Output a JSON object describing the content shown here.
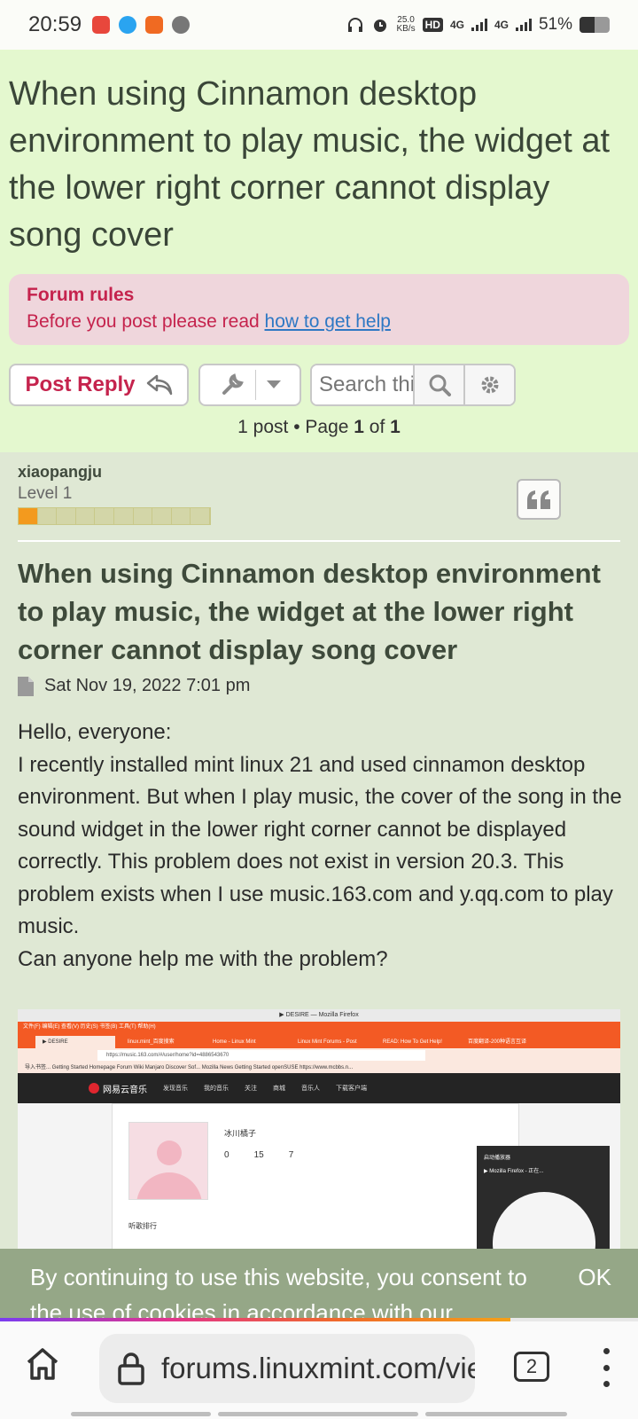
{
  "status_bar": {
    "time": "20:59",
    "net_speed_value": "25.0",
    "net_speed_unit": "KB/s",
    "hd_label": "HD",
    "signal1": "4G",
    "signal2": "4G",
    "battery_text": "51%",
    "battery_level": 0.51,
    "app_icons": [
      "netease-music-icon",
      "qq-icon",
      "rocket-app-icon",
      "wechat-icon"
    ]
  },
  "topic": {
    "title": "When using Cinnamon desktop environment to play music, the widget at the lower right corner cannot display song cover"
  },
  "rules": {
    "title": "Forum rules",
    "text": "Before you post please read ",
    "link": "how to get help"
  },
  "toolbar": {
    "post_reply": "Post Reply",
    "search_placeholder": "Search this topic…"
  },
  "pagination": {
    "prefix": "1 post • Page ",
    "current": "1",
    "of": " of ",
    "total": "1"
  },
  "post": {
    "author": "xiaopangju",
    "rank": "Level 1",
    "rank_level": 1,
    "rank_max": 10,
    "title": "When using Cinnamon desktop environment to play music, the widget at the lower right corner cannot display song cover",
    "date": "Sat Nov 19, 2022 7:01 pm",
    "body": [
      "Hello, everyone:",
      "I recently installed mint linux 21 and used cinnamon desktop environment. But when I play music, the cover of the song in the sound widget in the lower right corner cannot be displayed correctly. This problem does not exist in version 20.3. This problem exists when I use music.163.com and y.qq.com to play music.",
      "Can anyone help me with the problem?"
    ]
  },
  "attachment": {
    "window_title": "▶ DESIRE — Mozilla Firefox",
    "menubar": "文件(F)  编辑(E)  查看(V)  历史(S)  书签(B)  工具(T)  帮助(H)",
    "tabs": [
      "▶ DESIRE",
      "linux.mint_百度搜索",
      "Home - Linux Mint",
      "Linux Mint Forums - Post",
      "READ: How To Get Help!",
      "百度翻译-200种语言互译"
    ],
    "url": "https://music.163.com/#/user/home?id=4886543670",
    "bookmarks": "导入书签...  Getting Started  Homepage  Forum  Wiki  Manjaro Discover Sof...  Mozilla News  Getting Started  openSUSE  https://www.mcbbs.n...",
    "site_logo": "网易云音乐",
    "site_nav": [
      "发现音乐",
      "我的音乐",
      "关注",
      "商城",
      "音乐人",
      "下载客户端"
    ],
    "profile_name": "冰川橘子",
    "stats": [
      "0",
      "15",
      "7"
    ],
    "rank_label": "听歌排行",
    "player_title": "启动播放器",
    "player_item": "▶ Mozilla Firefox - 正在..."
  },
  "cookie": {
    "text": "By continuing to use this website, you consent to the use of cookies in accordance with our",
    "ok": "OK"
  },
  "browser": {
    "url": "forums.linuxmint.com/viewtopic.php",
    "tab_count": "2",
    "load_progress": 0.8
  }
}
